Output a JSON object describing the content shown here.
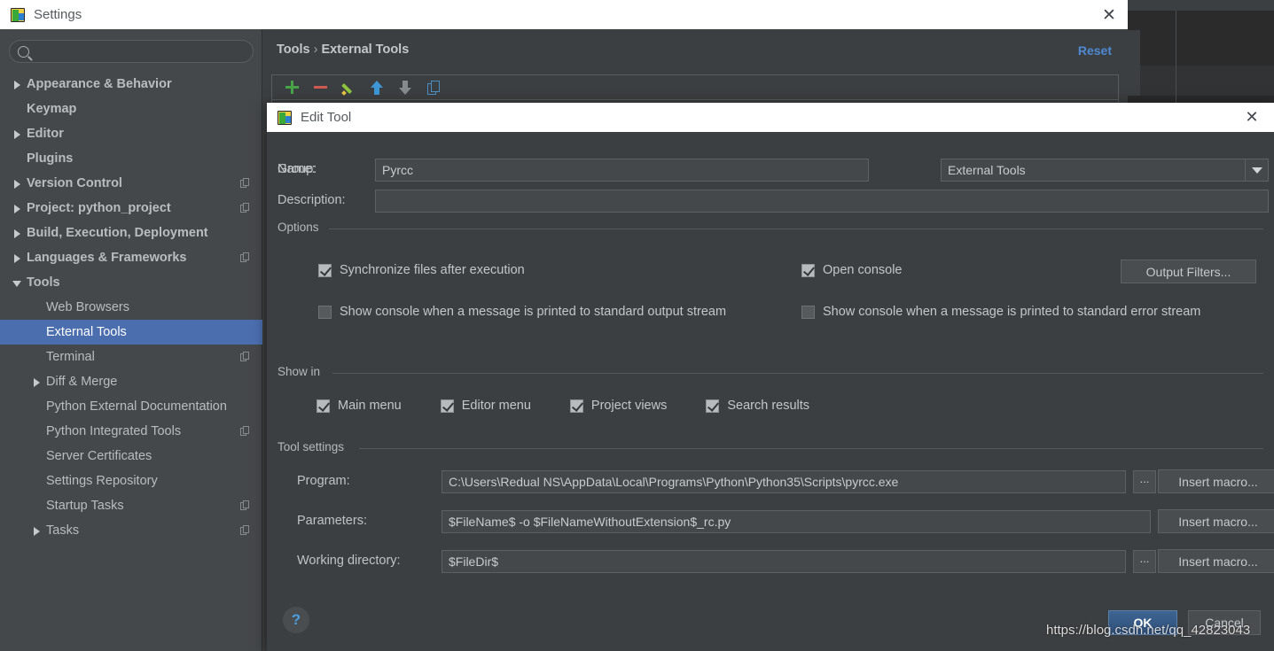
{
  "settings_window": {
    "title": "Settings",
    "icon": "pycharm-icon",
    "close_icon": "close-icon",
    "search": {
      "placeholder": "",
      "value": "",
      "icon": "search-icon"
    },
    "tree": [
      {
        "label": "Appearance & Behavior",
        "arrow": "right",
        "indent": 0,
        "bold": true,
        "selected": false,
        "badge": false
      },
      {
        "label": "Keymap",
        "arrow": "none",
        "indent": 0,
        "bold": true,
        "selected": false,
        "badge": false
      },
      {
        "label": "Editor",
        "arrow": "right",
        "indent": 0,
        "bold": true,
        "selected": false,
        "badge": false
      },
      {
        "label": "Plugins",
        "arrow": "none",
        "indent": 0,
        "bold": true,
        "selected": false,
        "badge": false
      },
      {
        "label": "Version Control",
        "arrow": "right",
        "indent": 0,
        "bold": true,
        "selected": false,
        "badge": true
      },
      {
        "label": "Project: python_project",
        "arrow": "right",
        "indent": 0,
        "bold": true,
        "selected": false,
        "badge": true
      },
      {
        "label": "Build, Execution, Deployment",
        "arrow": "right",
        "indent": 0,
        "bold": true,
        "selected": false,
        "badge": false
      },
      {
        "label": "Languages & Frameworks",
        "arrow": "right",
        "indent": 0,
        "bold": true,
        "selected": false,
        "badge": true
      },
      {
        "label": "Tools",
        "arrow": "down",
        "indent": 0,
        "bold": true,
        "selected": false,
        "badge": false
      },
      {
        "label": "Web Browsers",
        "arrow": "none",
        "indent": 1,
        "bold": false,
        "selected": false,
        "badge": false
      },
      {
        "label": "External Tools",
        "arrow": "none",
        "indent": 1,
        "bold": false,
        "selected": true,
        "badge": false
      },
      {
        "label": "Terminal",
        "arrow": "none",
        "indent": 1,
        "bold": false,
        "selected": false,
        "badge": true
      },
      {
        "label": "Diff & Merge",
        "arrow": "right",
        "indent": 1,
        "bold": false,
        "selected": false,
        "badge": false
      },
      {
        "label": "Python External Documentation",
        "arrow": "none",
        "indent": 1,
        "bold": false,
        "selected": false,
        "badge": false
      },
      {
        "label": "Python Integrated Tools",
        "arrow": "none",
        "indent": 1,
        "bold": false,
        "selected": false,
        "badge": true
      },
      {
        "label": "Server Certificates",
        "arrow": "none",
        "indent": 1,
        "bold": false,
        "selected": false,
        "badge": false
      },
      {
        "label": "Settings Repository",
        "arrow": "none",
        "indent": 1,
        "bold": false,
        "selected": false,
        "badge": false
      },
      {
        "label": "Startup Tasks",
        "arrow": "none",
        "indent": 1,
        "bold": false,
        "selected": false,
        "badge": true
      },
      {
        "label": "Tasks",
        "arrow": "right",
        "indent": 1,
        "bold": false,
        "selected": false,
        "badge": true
      }
    ],
    "content": {
      "breadcrumb_root": "Tools",
      "breadcrumb_sep": "›",
      "breadcrumb_leaf": "External Tools",
      "reset_label": "Reset",
      "toolbar": [
        {
          "name": "add-button",
          "icon": "plus-icon"
        },
        {
          "name": "remove-button",
          "icon": "minus-icon"
        },
        {
          "name": "edit-button",
          "icon": "pencil-icon"
        },
        {
          "name": "move-up-button",
          "icon": "arrow-up-icon"
        },
        {
          "name": "move-down-button",
          "icon": "arrow-down-icon"
        },
        {
          "name": "copy-button",
          "icon": "copy-icon"
        }
      ]
    }
  },
  "edit_tool_dialog": {
    "title": "Edit Tool",
    "icon": "pycharm-icon",
    "close_icon": "close-icon",
    "name_label": "Name:",
    "name_value": "Pyrcc",
    "name_placeholder": "",
    "group_label": "Group:",
    "group_value": "External Tools",
    "group_options": [
      "External Tools"
    ],
    "description_label": "Description:",
    "description_value": "",
    "description_placeholder": "",
    "options": {
      "legend": "Options",
      "sync_files": {
        "label": "Synchronize files after execution",
        "checked": true
      },
      "open_console": {
        "label": "Open console",
        "checked": true
      },
      "output_filters_button": "Output Filters...",
      "show_console_stdout": {
        "label": "Show console when a message is printed to standard output stream",
        "checked": false
      },
      "show_console_stderr": {
        "label": "Show console when a message is printed to standard error stream",
        "checked": false
      }
    },
    "show_in": {
      "legend": "Show in",
      "items": [
        {
          "label": "Main menu",
          "checked": true
        },
        {
          "label": "Editor menu",
          "checked": true
        },
        {
          "label": "Project views",
          "checked": true
        },
        {
          "label": "Search results",
          "checked": true
        }
      ]
    },
    "tool_settings": {
      "legend": "Tool settings",
      "program": {
        "label": "Program:",
        "value": "C:\\Users\\Redual NS\\AppData\\Local\\Programs\\Python\\Python35\\Scripts\\pyrcc.exe",
        "browse_label": "...",
        "macro_label": "Insert macro..."
      },
      "parameters": {
        "label": "Parameters:",
        "value": "$FileName$ -o $FileNameWithoutExtension$_rc.py",
        "macro_label": "Insert macro..."
      },
      "working_directory": {
        "label": "Working directory:",
        "value": "$FileDir$",
        "browse_label": "...",
        "macro_label": "Insert macro..."
      }
    },
    "help_label": "?",
    "ok_label": "OK",
    "cancel_label": "Cancel"
  },
  "watermark": "https://blog.csdn.net/qq_42823043",
  "colors": {
    "accent_blue": "#4e8ad4",
    "selection_blue": "#4b6eaf",
    "panel_bg": "#3c3f41",
    "sidebar_bg": "#45484a",
    "titlebar_bg": "#ffffff",
    "add_green": "#47a447",
    "remove_red": "#cf5b52"
  }
}
